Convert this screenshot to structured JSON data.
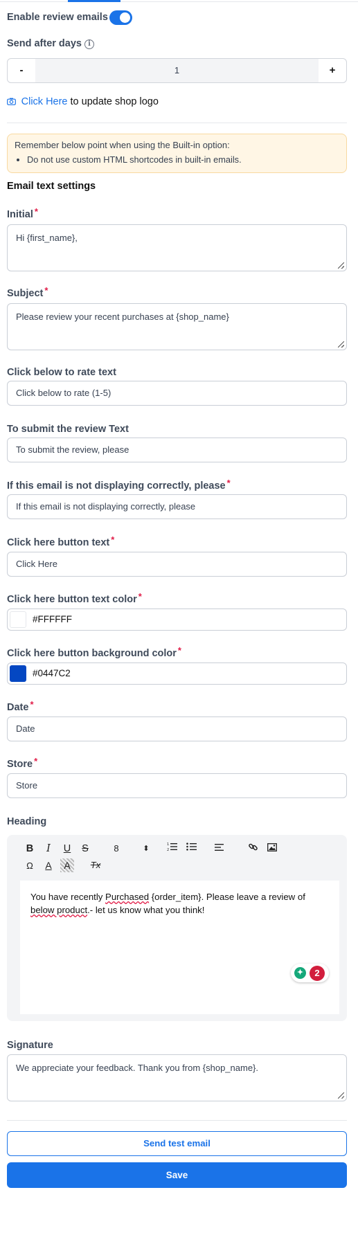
{
  "header": {
    "enable_reviews_label": "Enable review emails",
    "enable_reviews_on": true
  },
  "send_after": {
    "label": "Send after days",
    "value": "1",
    "minus": "-",
    "plus": "+"
  },
  "logo": {
    "link_text": "Click Here",
    "suffix": " to update shop logo"
  },
  "notice": {
    "title": "Remember below point when using the Built-in option:",
    "points": [
      "Do not use custom HTML shortcodes in built-in emails."
    ]
  },
  "section_title": "Email text settings",
  "fields": {
    "initial": {
      "label": "Initial",
      "value": "Hi {first_name},"
    },
    "subject": {
      "label": "Subject",
      "value": "Please review your recent purchases at {shop_name}"
    },
    "rate_text": {
      "label": "Click below to rate text",
      "value": "Click below to rate (1-5)"
    },
    "submit_text": {
      "label": "To submit the review Text",
      "value": "To submit the review, please"
    },
    "not_displaying": {
      "label": "If this email is not displaying correctly, please",
      "value": "If this email is not displaying correctly, please"
    },
    "button_text": {
      "label": "Click here button text",
      "value": "Click Here"
    },
    "button_text_color": {
      "label": "Click here button text color",
      "value": "#FFFFFF"
    },
    "button_bg_color": {
      "label": "Click here button background color",
      "value": "#0447C2"
    },
    "date": {
      "label": "Date",
      "value": "Date"
    },
    "store": {
      "label": "Store",
      "value": "Store"
    }
  },
  "heading": {
    "label": "Heading",
    "toolbar": {
      "bold": "B",
      "italic": "I",
      "underline": "U",
      "strike": "S",
      "font_size": "8",
      "size_arrows": "⬍",
      "special_char": "Ω",
      "font_color": "A",
      "highlight": "A",
      "clear_format": "Tx"
    },
    "body_parts": [
      "You have recently ",
      "Purchased",
      " {order_item}. Please leave a review of ",
      "below product",
      ".- let us know what you think!"
    ],
    "grammar_count": "2"
  },
  "signature": {
    "label": "Signature",
    "value": "We appreciate your feedback. Thank you from {shop_name}."
  },
  "actions": {
    "send_test": "Send test email",
    "save": "Save"
  },
  "colors": {
    "accent": "#1a73e8",
    "required": "#e11d48",
    "notice_bg": "#fff6e5"
  }
}
